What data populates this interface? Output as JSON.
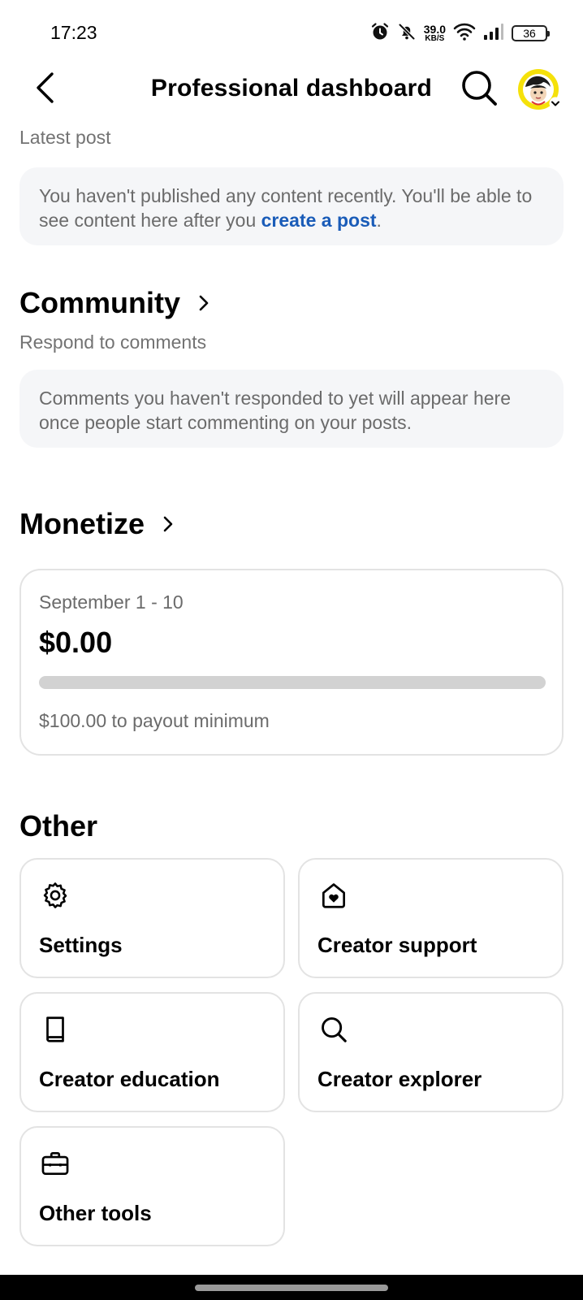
{
  "status_bar": {
    "time": "17:23",
    "net_speed_value": "39.0",
    "net_speed_unit": "KB/S",
    "battery": "36",
    "icons": [
      "alarm-icon",
      "mute-bell-icon",
      "wifi-icon",
      "signal-icon",
      "battery-icon"
    ]
  },
  "header": {
    "title": "Professional dashboard",
    "back_icon": "back-arrow-icon",
    "search_icon": "search-icon",
    "avatar_icon": "avatar"
  },
  "latest_post": {
    "subtitle": "Latest post",
    "text_before": "You haven't published any content recently. You'll be able to see content here after you ",
    "link": "create a post",
    "text_after": "."
  },
  "community": {
    "title": "Community",
    "subtitle": "Respond to comments",
    "empty_text": "Comments you haven't responded to yet will appear here once people start commenting on your posts."
  },
  "monetize": {
    "title": "Monetize",
    "period": "September 1 - 10",
    "amount": "$0.00",
    "progress_fraction": 0,
    "payout_text": "$100.00 to payout minimum"
  },
  "other": {
    "title": "Other",
    "tiles": [
      {
        "label": "Settings",
        "icon": "gear-icon"
      },
      {
        "label": "Creator support",
        "icon": "heart-house-icon"
      },
      {
        "label": "Creator education",
        "icon": "book-icon"
      },
      {
        "label": "Creator explorer",
        "icon": "search-icon"
      },
      {
        "label": "Other tools",
        "icon": "briefcase-icon"
      }
    ]
  },
  "colors": {
    "link": "#1a5cb8",
    "muted_text": "#6b6b6b",
    "box_background": "#f5f6f8",
    "progress_track": "#d2d2d2"
  }
}
